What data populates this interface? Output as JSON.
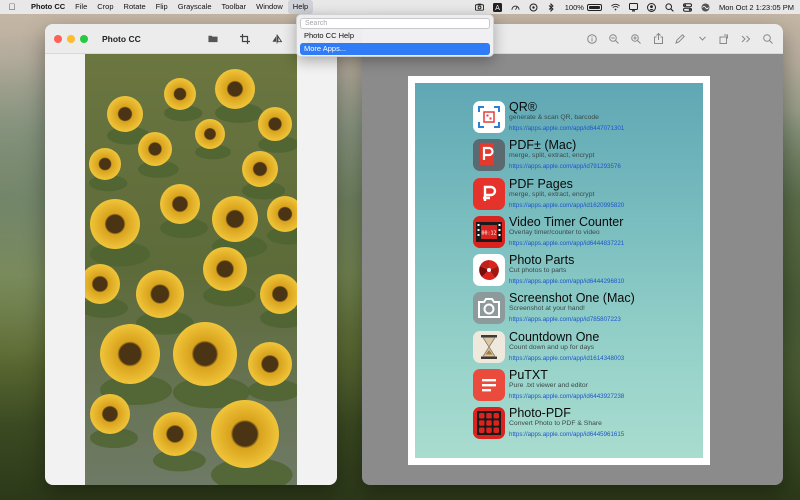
{
  "menubar": {
    "app_name": "Photo CC",
    "items": [
      "File",
      "Crop",
      "Rotate",
      "Flip",
      "Grayscale",
      "Toolbar",
      "Window",
      "Help"
    ],
    "battery": "100%",
    "clock": "Mon Oct 2  1:23:05 PM"
  },
  "help_menu": {
    "search_placeholder": "Search",
    "items": [
      "Photo CC Help",
      "More Apps..."
    ]
  },
  "photo_window": {
    "title": "Photo CC",
    "toolbar_icons": [
      "folder-icon",
      "crop-icon",
      "flip-icon",
      "filter-icon"
    ]
  },
  "preview_window": {
    "toolbar_icons": [
      "info-icon",
      "zoom-out-icon",
      "zoom-in-icon",
      "share-icon",
      "markup-icon",
      "chevron-down-icon",
      "rotate-icon",
      "more-icon",
      "search-icon"
    ],
    "apps": [
      {
        "name": "QR®",
        "desc": "generate & scan QR, barcode",
        "url": "https://apps.apple.com/app/id6447071301",
        "icon": "qr-app-icon",
        "color": "#ffffff"
      },
      {
        "name": "PDF± (Mac)",
        "desc": "merge, split, extract, encrypt",
        "url": "https://apps.apple.com/app/id791293576",
        "icon": "pdf-mac-app-icon",
        "color": "#5a6a70"
      },
      {
        "name": "PDF Pages",
        "desc": "merge, split, extract, encrypt",
        "url": "https://apps.apple.com/app/id1620995820",
        "icon": "pdf-pages-app-icon",
        "color": "#e5322b"
      },
      {
        "name": "Video Timer Counter",
        "desc": "Overlay timer/counter to video",
        "url": "https://apps.apple.com/app/id6444837221",
        "icon": "video-timer-app-icon",
        "color": "#d8231f"
      },
      {
        "name": "Photo Parts",
        "desc": "Cut photos to parts",
        "url": "https://apps.apple.com/app/id6444296810",
        "icon": "photo-parts-app-icon",
        "color": "#ffffff"
      },
      {
        "name": "Screenshot One (Mac)",
        "desc": "Screenshot at your hand!",
        "url": "https://apps.apple.com/app/id785807223",
        "icon": "screenshot-app-icon",
        "color": "#8d9a9c"
      },
      {
        "name": "Countdown One",
        "desc": "Count down and up for days",
        "url": "https://apps.apple.com/app/id1614348003",
        "icon": "countdown-app-icon",
        "color": "#efe8dc"
      },
      {
        "name": "PuTXT",
        "desc": "Pure .txt viewer and editor",
        "url": "https://apps.apple.com/app/id6443927238",
        "icon": "putxt-app-icon",
        "color": "#ea4b3d"
      },
      {
        "name": "Photo-PDF",
        "desc": "Convert Photo to PDF & Share",
        "url": "https://apps.apple.com/app/id6445961615",
        "icon": "photo-pdf-app-icon",
        "color": "#d8231f"
      }
    ]
  }
}
